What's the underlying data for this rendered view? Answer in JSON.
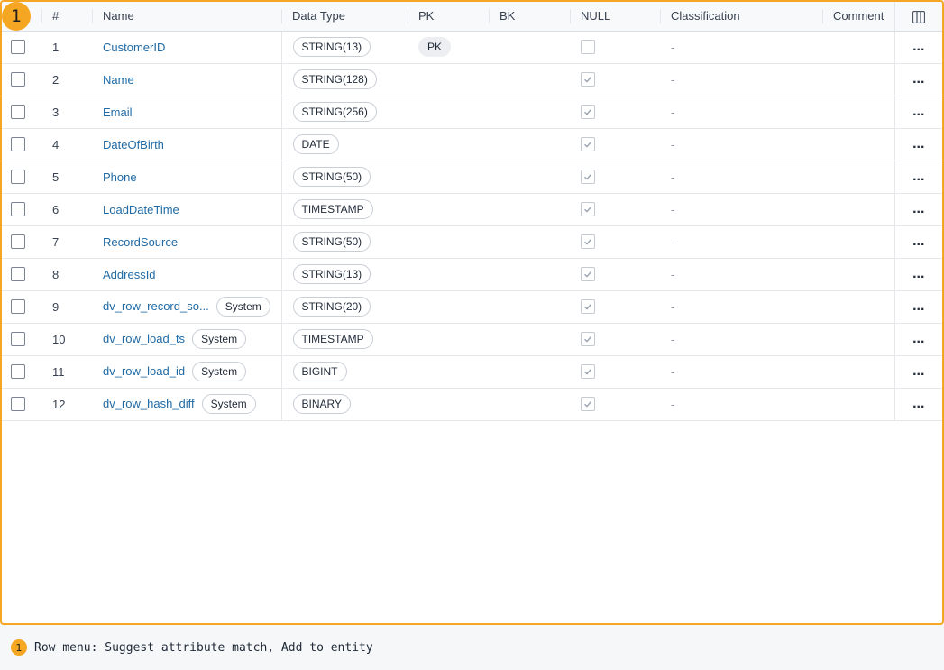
{
  "marker_label": "1",
  "columns": {
    "index": "#",
    "name": "Name",
    "data_type": "Data Type",
    "pk": "PK",
    "bk": "BK",
    "null": "NULL",
    "classification": "Classification",
    "comment": "Comment",
    "column_picker_icon": "columns-icon"
  },
  "rows": [
    {
      "index": "1",
      "name": "CustomerID",
      "system": "",
      "data_type": "STRING(13)",
      "pk": "PK",
      "null_checked": false,
      "classification": "-"
    },
    {
      "index": "2",
      "name": "Name",
      "system": "",
      "data_type": "STRING(128)",
      "pk": "",
      "null_checked": true,
      "classification": "-"
    },
    {
      "index": "3",
      "name": "Email",
      "system": "",
      "data_type": "STRING(256)",
      "pk": "",
      "null_checked": true,
      "classification": "-"
    },
    {
      "index": "4",
      "name": "DateOfBirth",
      "system": "",
      "data_type": "DATE",
      "pk": "",
      "null_checked": true,
      "classification": "-"
    },
    {
      "index": "5",
      "name": "Phone",
      "system": "",
      "data_type": "STRING(50)",
      "pk": "",
      "null_checked": true,
      "classification": "-"
    },
    {
      "index": "6",
      "name": "LoadDateTime",
      "system": "",
      "data_type": "TIMESTAMP",
      "pk": "",
      "null_checked": true,
      "classification": "-"
    },
    {
      "index": "7",
      "name": "RecordSource",
      "system": "",
      "data_type": "STRING(50)",
      "pk": "",
      "null_checked": true,
      "classification": "-"
    },
    {
      "index": "8",
      "name": "AddressId",
      "system": "",
      "data_type": "STRING(13)",
      "pk": "",
      "null_checked": true,
      "classification": "-"
    },
    {
      "index": "9",
      "name": "dv_row_record_so...",
      "system": "System",
      "data_type": "STRING(20)",
      "pk": "",
      "null_checked": true,
      "classification": "-"
    },
    {
      "index": "10",
      "name": "dv_row_load_ts",
      "system": "System",
      "data_type": "TIMESTAMP",
      "pk": "",
      "null_checked": true,
      "classification": "-"
    },
    {
      "index": "11",
      "name": "dv_row_load_id",
      "system": "System",
      "data_type": "BIGINT",
      "pk": "",
      "null_checked": true,
      "classification": "-"
    },
    {
      "index": "12",
      "name": "dv_row_hash_diff",
      "system": "System",
      "data_type": "BINARY",
      "pk": "",
      "null_checked": true,
      "classification": "-"
    }
  ],
  "row_menu_label": "...",
  "caption": {
    "badge": "1",
    "text": "Row menu: Suggest attribute match, Add to entity"
  },
  "colors": {
    "highlight": "#f5a623",
    "link": "#1f6aa5"
  }
}
